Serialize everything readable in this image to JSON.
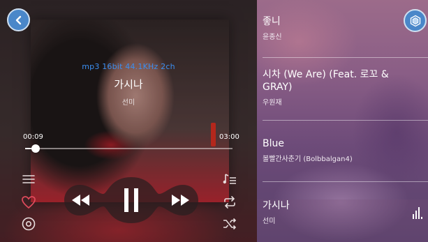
{
  "player": {
    "format": "mp3 16bit 44.1KHz 2ch",
    "title": "가시나",
    "artist": "선미",
    "time_elapsed": "00:09",
    "time_total": "03:00",
    "progress": 0.05
  },
  "icons": {
    "back": "chevron-left-icon",
    "menu": "menu-lines-icon",
    "favorite": "heart-icon",
    "disc": "disc-icon",
    "playlist": "music-list-icon",
    "repeat": "repeat-icon",
    "shuffle": "shuffle-icon",
    "previous": "rewind-icon",
    "pause": "pause-icon",
    "next": "fast-forward-icon",
    "equalizer": "equalizer-bars-icon",
    "settings": "hexagon-logo-icon"
  },
  "colors": {
    "accent": "#4a87c9",
    "format_text": "#3b8ef0",
    "favorite": "#e04a5c"
  },
  "playlist": {
    "items": [
      {
        "title": "좋니",
        "artist": "윤종신"
      },
      {
        "title": "시차 (We Are) (Feat. 로꼬 & GRAY)",
        "artist": "우원재"
      },
      {
        "title": "Blue",
        "artist": "볼빨간사춘기 (Bolbbalgan4)"
      },
      {
        "title": "가시나",
        "artist": "선미"
      }
    ]
  }
}
